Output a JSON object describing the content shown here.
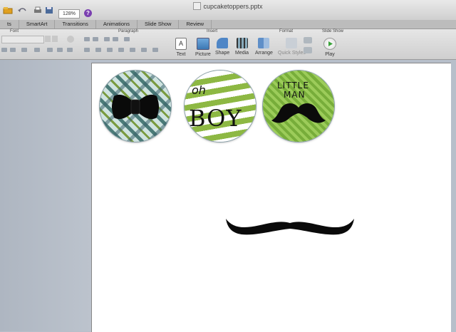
{
  "window": {
    "title": "cupcaketoppers.pptx"
  },
  "toolbar": {
    "zoom": "128%",
    "help": "?"
  },
  "tabs": [
    "ts",
    "SmartArt",
    "Transitions",
    "Animations",
    "Slide Show",
    "Review"
  ],
  "ribbon": {
    "groups": {
      "font": "Font",
      "paragraph": "Paragraph",
      "insert": "Insert",
      "format": "Format",
      "slideshow": "Slide Show"
    },
    "insert_buttons": [
      "Text",
      "Picture",
      "Shape",
      "Media"
    ],
    "format_buttons": [
      "Arrange",
      "Quick Styles"
    ],
    "play": "Play"
  },
  "slide": {
    "topper_2": {
      "line1": "oh",
      "line2": "BOY"
    },
    "topper_3": {
      "line1": "LITTLE",
      "line2": "MAN"
    }
  },
  "colors": {
    "accent_green": "#8db843",
    "teal": "#4b7b78",
    "mustache": "#000000",
    "play_green": "#3aa33a"
  }
}
